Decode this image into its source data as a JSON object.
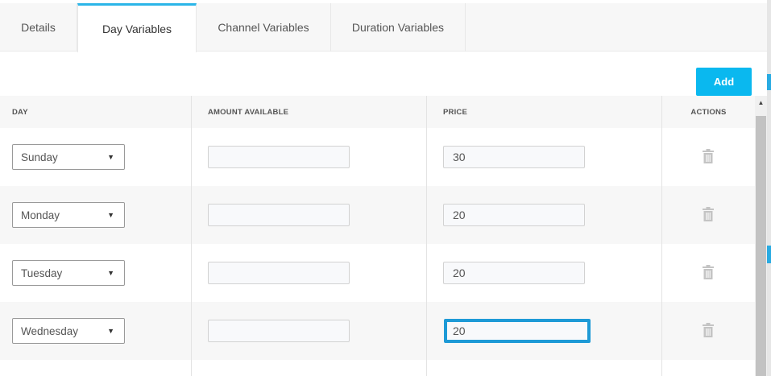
{
  "tabs": [
    {
      "label": "Details",
      "active": false
    },
    {
      "label": "Day Variables",
      "active": true
    },
    {
      "label": "Channel Variables",
      "active": false
    },
    {
      "label": "Duration Variables",
      "active": false
    }
  ],
  "toolbar": {
    "add_label": "Add"
  },
  "table": {
    "headers": {
      "day": "DAY",
      "amount": "AMOUNT AVAILABLE",
      "price": "PRICE",
      "actions": "ACTIONS"
    },
    "rows": [
      {
        "day": "Sunday",
        "amount": "",
        "price": "30",
        "focused": false
      },
      {
        "day": "Monday",
        "amount": "",
        "price": "20",
        "focused": false
      },
      {
        "day": "Tuesday",
        "amount": "",
        "price": "20",
        "focused": false
      },
      {
        "day": "Wednesday",
        "amount": "",
        "price": "20",
        "focused": true
      }
    ],
    "row_action_icon": "trash-icon"
  },
  "colors": {
    "accent": "#0ab8ef",
    "focus_border": "#1e9ad6",
    "tab_active_border": "#2bb5e8"
  }
}
